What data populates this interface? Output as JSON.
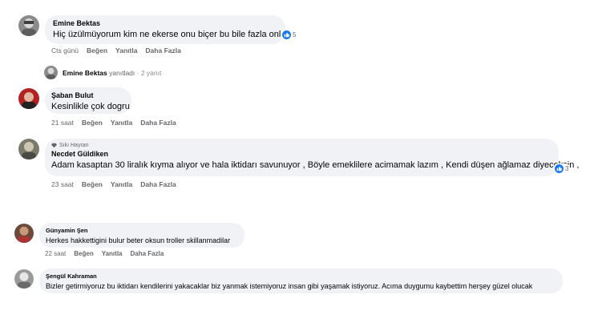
{
  "comments": [
    {
      "author": "Emine Bektas",
      "text": "Hiç üzülmüyorum kim ne ekerse onu biçer bu bile fazla onlara",
      "reactions": "5",
      "time": "Cts günü",
      "like": "Beğen",
      "reply": "Yanıtla",
      "more": "Daha Fazla"
    },
    {
      "author": "Şaban Bulut",
      "text": "Kesinlikle çok dogru",
      "time": "21 saat",
      "like": "Beğen",
      "reply": "Yanıtla",
      "more": "Daha Fazla"
    },
    {
      "badge": "Sıkı Hayran",
      "author": "Necdet Güldiken",
      "text": "Adam kasaptan 30 liralık kıyma alıyor ve hala iktidarı savunuyor , Böyle emeklilere acimamak lazım , Kendi düşen ağlamaz diyeceksin ,",
      "reactions": "3",
      "time": "23 saat",
      "like": "Beğen",
      "reply": "Yanıtla",
      "more": "Daha Fazla"
    },
    {
      "author": "Günyamin Şen",
      "text": "Herkes hakkettigini bulur beter oksun troller skillanmadilar",
      "time": "22 saat",
      "like": "Beğen",
      "reply": "Yanıtla",
      "more": "Daha Fazla"
    },
    {
      "author": "Şengül Kahraman",
      "text": "Bizler getirmiyoruz bu iktidarı kendilerini yakacaklar biz yanmak istemiyoruz insan gibi yaşamak istiyoruz. Acıma duygumu kaybettim herşey güzel olucak"
    }
  ],
  "reply_summary": {
    "author": "Emine Bektas",
    "action": "yanıtladı",
    "time": "· 2 yanıt"
  },
  "colors": {
    "bubble": "#f0f2f5",
    "like_blue": "#1877f2",
    "meta_gray": "#65676b"
  },
  "icons": {
    "like": "thumbs-up-icon",
    "badge": "diamond-icon"
  }
}
